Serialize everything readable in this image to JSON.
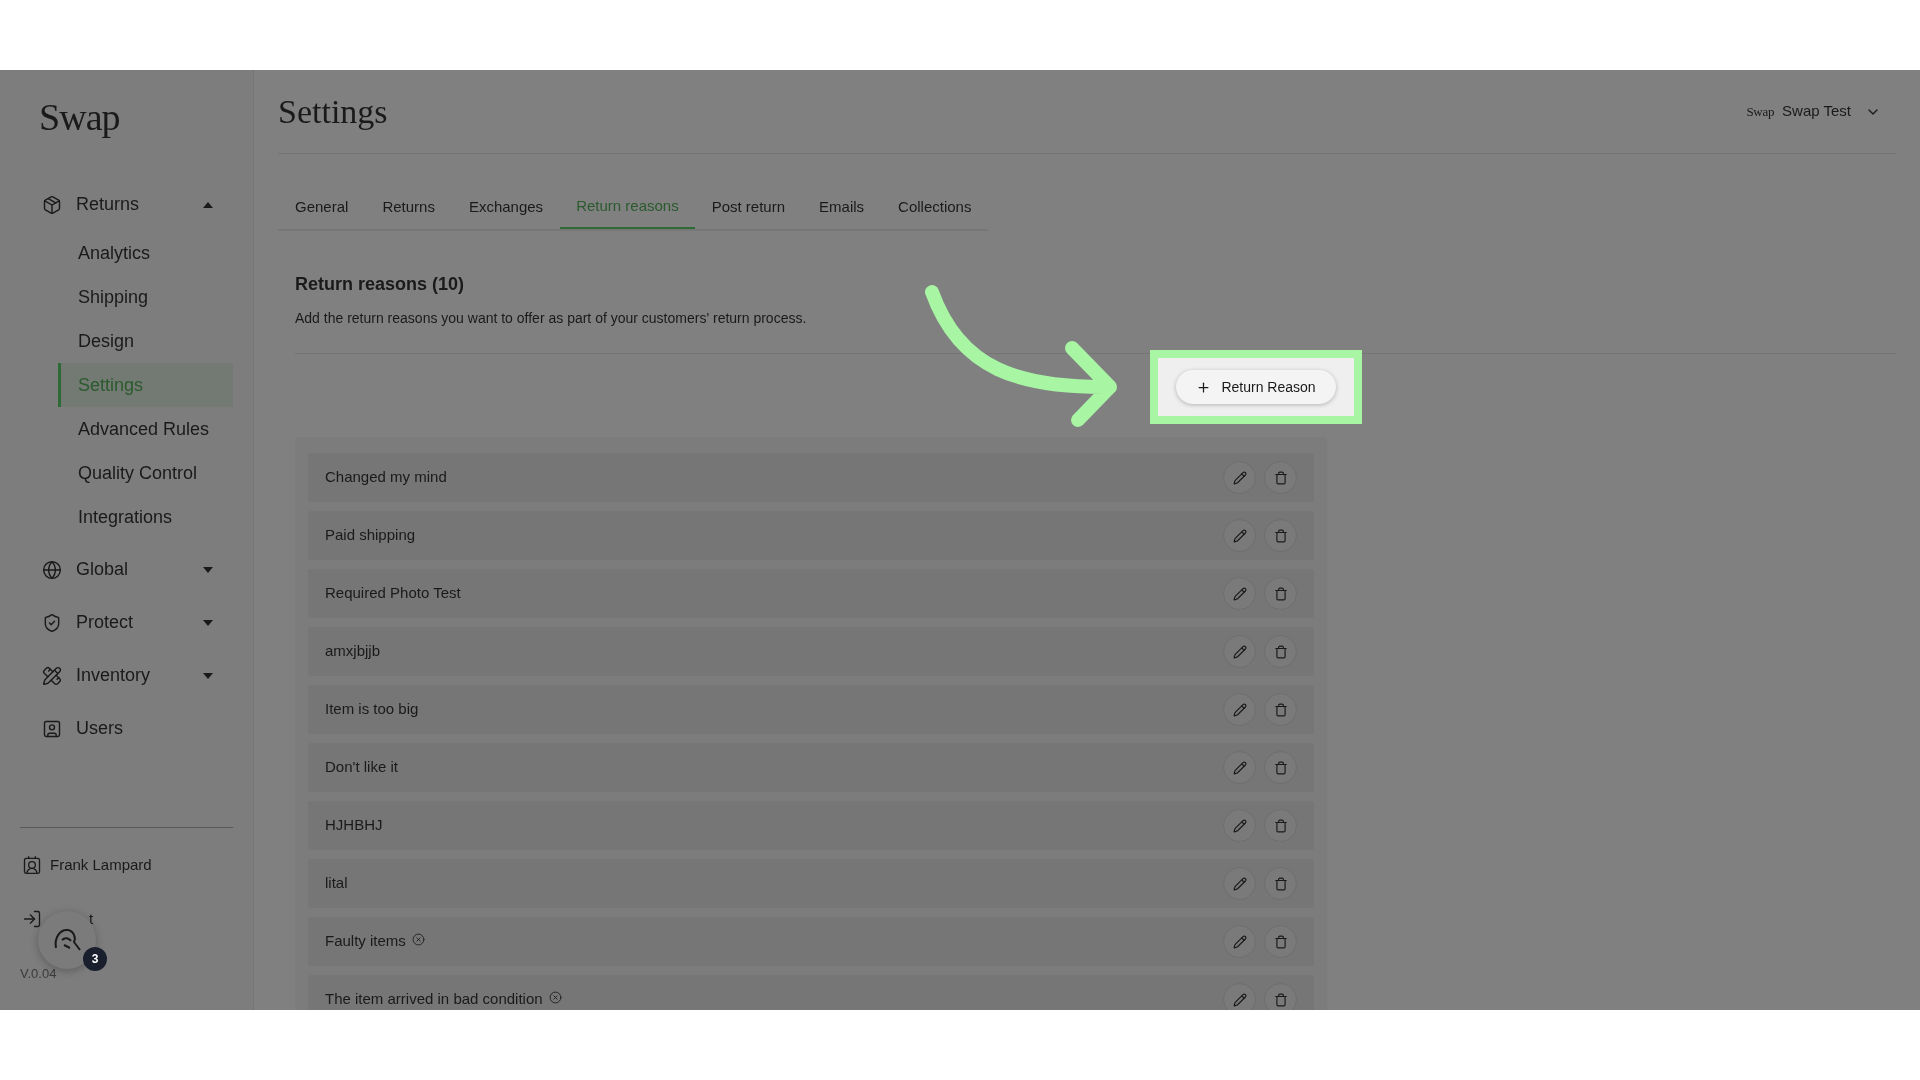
{
  "sidebar": {
    "logo": "Swap",
    "nav": [
      {
        "label": "Returns",
        "expanded": true,
        "children": [
          {
            "label": "Analytics",
            "selected": false
          },
          {
            "label": "Shipping",
            "selected": false
          },
          {
            "label": "Design",
            "selected": false
          },
          {
            "label": "Settings",
            "selected": true
          },
          {
            "label": "Advanced Rules",
            "selected": false
          },
          {
            "label": "Quality Control",
            "selected": false
          },
          {
            "label": "Integrations",
            "selected": false
          }
        ]
      },
      {
        "label": "Global",
        "expanded": false
      },
      {
        "label": "Protect",
        "expanded": false
      },
      {
        "label": "Inventory",
        "expanded": false
      },
      {
        "label": "Users"
      }
    ],
    "user": "Frank Lampard",
    "logout": "t",
    "version": "V.0.04",
    "support_badge": "3"
  },
  "header": {
    "title": "Settings",
    "account": {
      "logo": "Swap",
      "name": "Swap Test"
    }
  },
  "tabs": [
    {
      "label": "General",
      "selected": false
    },
    {
      "label": "Returns",
      "selected": false
    },
    {
      "label": "Exchanges",
      "selected": false
    },
    {
      "label": "Return reasons",
      "selected": true
    },
    {
      "label": "Post return",
      "selected": false
    },
    {
      "label": "Emails",
      "selected": false
    },
    {
      "label": "Collections",
      "selected": false
    }
  ],
  "section": {
    "title": "Return reasons (10)",
    "description": "Add the return reasons you want to offer as part of your customers' return process."
  },
  "add_button": "Return Reason",
  "reasons": [
    {
      "label": "Changed my mind",
      "flagged": false
    },
    {
      "label": "Paid shipping",
      "flagged": false
    },
    {
      "label": "Required Photo Test",
      "flagged": false
    },
    {
      "label": "amxjbjjb",
      "flagged": false
    },
    {
      "label": "Item is too big",
      "flagged": false
    },
    {
      "label": "Don't like it",
      "flagged": false
    },
    {
      "label": "HJHBHJ",
      "flagged": false
    },
    {
      "label": "lital",
      "flagged": false
    },
    {
      "label": "Faulty items",
      "flagged": true
    },
    {
      "label": "The item arrived in bad condition",
      "flagged": true
    }
  ]
}
